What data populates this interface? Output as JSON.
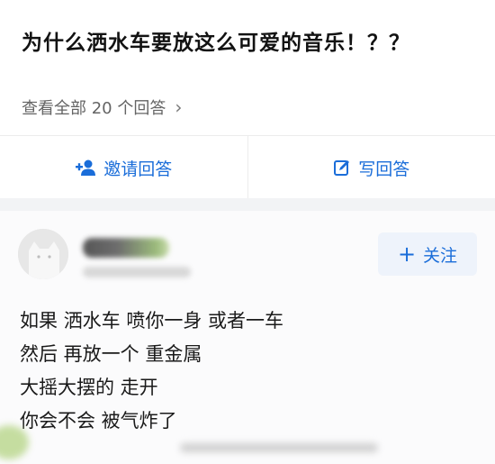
{
  "question": {
    "title": "为什么洒水车要放这么可爱的音乐！？？",
    "view_all": "查看全部 20 个回答",
    "chevron_icon": "chevron-right-icon"
  },
  "actions": {
    "invite_label": "邀请回答",
    "invite_icon": "add-person-icon",
    "write_label": "写回答",
    "write_icon": "edit-icon"
  },
  "answer": {
    "follow_label": "关注",
    "follow_icon": "plus-icon",
    "lines": [
      "如果 洒水车 喷你一身 或者一车",
      "然后 再放一个 重金属",
      "大摇大摆的 走开",
      "你会不会 被气炸了"
    ]
  },
  "colors": {
    "accent": "#1a6dd9",
    "muted_text": "#646464",
    "separator": "#f2f3f5"
  }
}
